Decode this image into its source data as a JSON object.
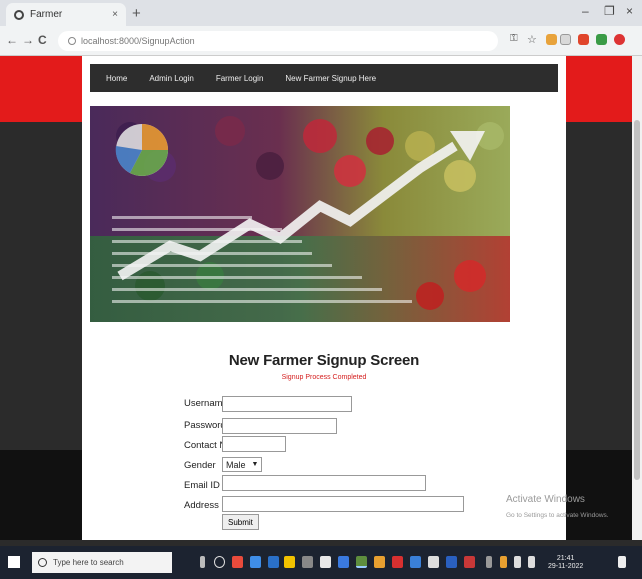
{
  "browser": {
    "tab_title": "Farmer",
    "tab_close": "×",
    "new_tab": "+",
    "minimize": "–",
    "restore": "❐",
    "close": "×",
    "back": "←",
    "forward": "→",
    "reload": "C",
    "url": "localhost:8000/SignupAction"
  },
  "nav": {
    "items": [
      "Home",
      "Admin Login",
      "Farmer Login",
      "New Farmer Signup Here"
    ]
  },
  "page": {
    "title": "New Farmer Signup Screen",
    "status_message": "Signup Process Completed"
  },
  "form": {
    "username_label": "Username",
    "password_label": "Password",
    "contact_label": "Contact No",
    "gender_label": "Gender",
    "gender_value": "Male",
    "email_label": "Email ID",
    "address_label": "Address",
    "submit_label": "Submit"
  },
  "watermark": {
    "line1": "Activate Windows",
    "line2": "Go to Settings to activate Windows."
  },
  "taskbar": {
    "search_placeholder": "Type here to search",
    "time": "21:41",
    "date": "29-11-2022"
  },
  "colors": {
    "accent_red": "#e31b1b",
    "nav_bg": "#2d2d2d",
    "status_red": "#d52020"
  }
}
